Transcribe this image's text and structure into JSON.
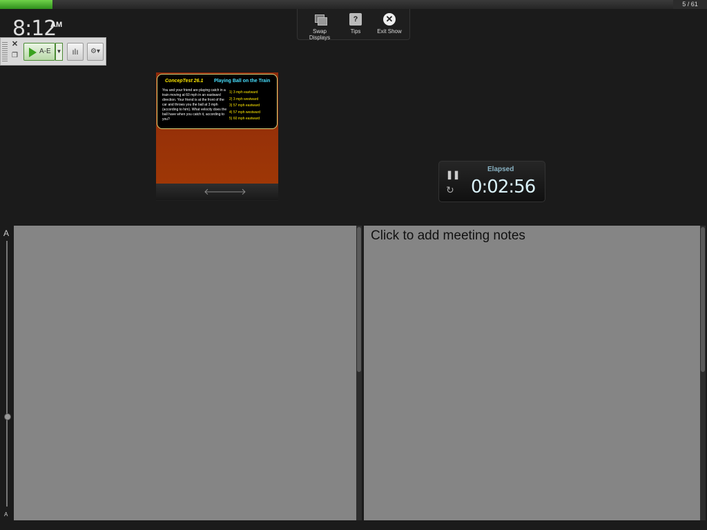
{
  "progress": {
    "fraction": 0.078,
    "counter": "5 / 61"
  },
  "clock": {
    "time": "8:12",
    "ampm": "AM"
  },
  "toolbar": {
    "play_label": "A-E",
    "close_glyph": "✕",
    "copy_glyph": "❐",
    "dropdown_glyph": "▼",
    "chart_glyph": "ılı",
    "settings_glyph": "⚙▾",
    "accent_color": "#3aa21f"
  },
  "top_menu": {
    "swap_label": "Swap Displays",
    "tips_label": "Tips",
    "tips_glyph": "?",
    "exit_label": "Exit Show",
    "exit_glyph": "✕"
  },
  "slide": {
    "title": "ConcepTest 26.1",
    "heading": "Playing Ball on the Train",
    "question": "You and your friend are playing catch in a train moving at 60 mph in an eastward direction. Your friend is at the front of the car and throws you the ball at 3 mph (according to him). What velocity does the ball have when you catch it, according to you?",
    "options": [
      "1)  3 mph eastward",
      "2)  3 mph westward",
      "3)  57 mph eastward",
      "4)  57 mph westward",
      "5)  60 mph eastward"
    ],
    "prev_glyph": "🡐",
    "next_glyph": "🡒"
  },
  "timer": {
    "label": "Elapsed",
    "value": "0:02:56",
    "pause_glyph": "❚❚",
    "reset_glyph": "↻"
  },
  "font_scale": {
    "large_label": "A",
    "small_label": "A"
  },
  "notes": {
    "placeholder": "Click to add meeting notes"
  }
}
